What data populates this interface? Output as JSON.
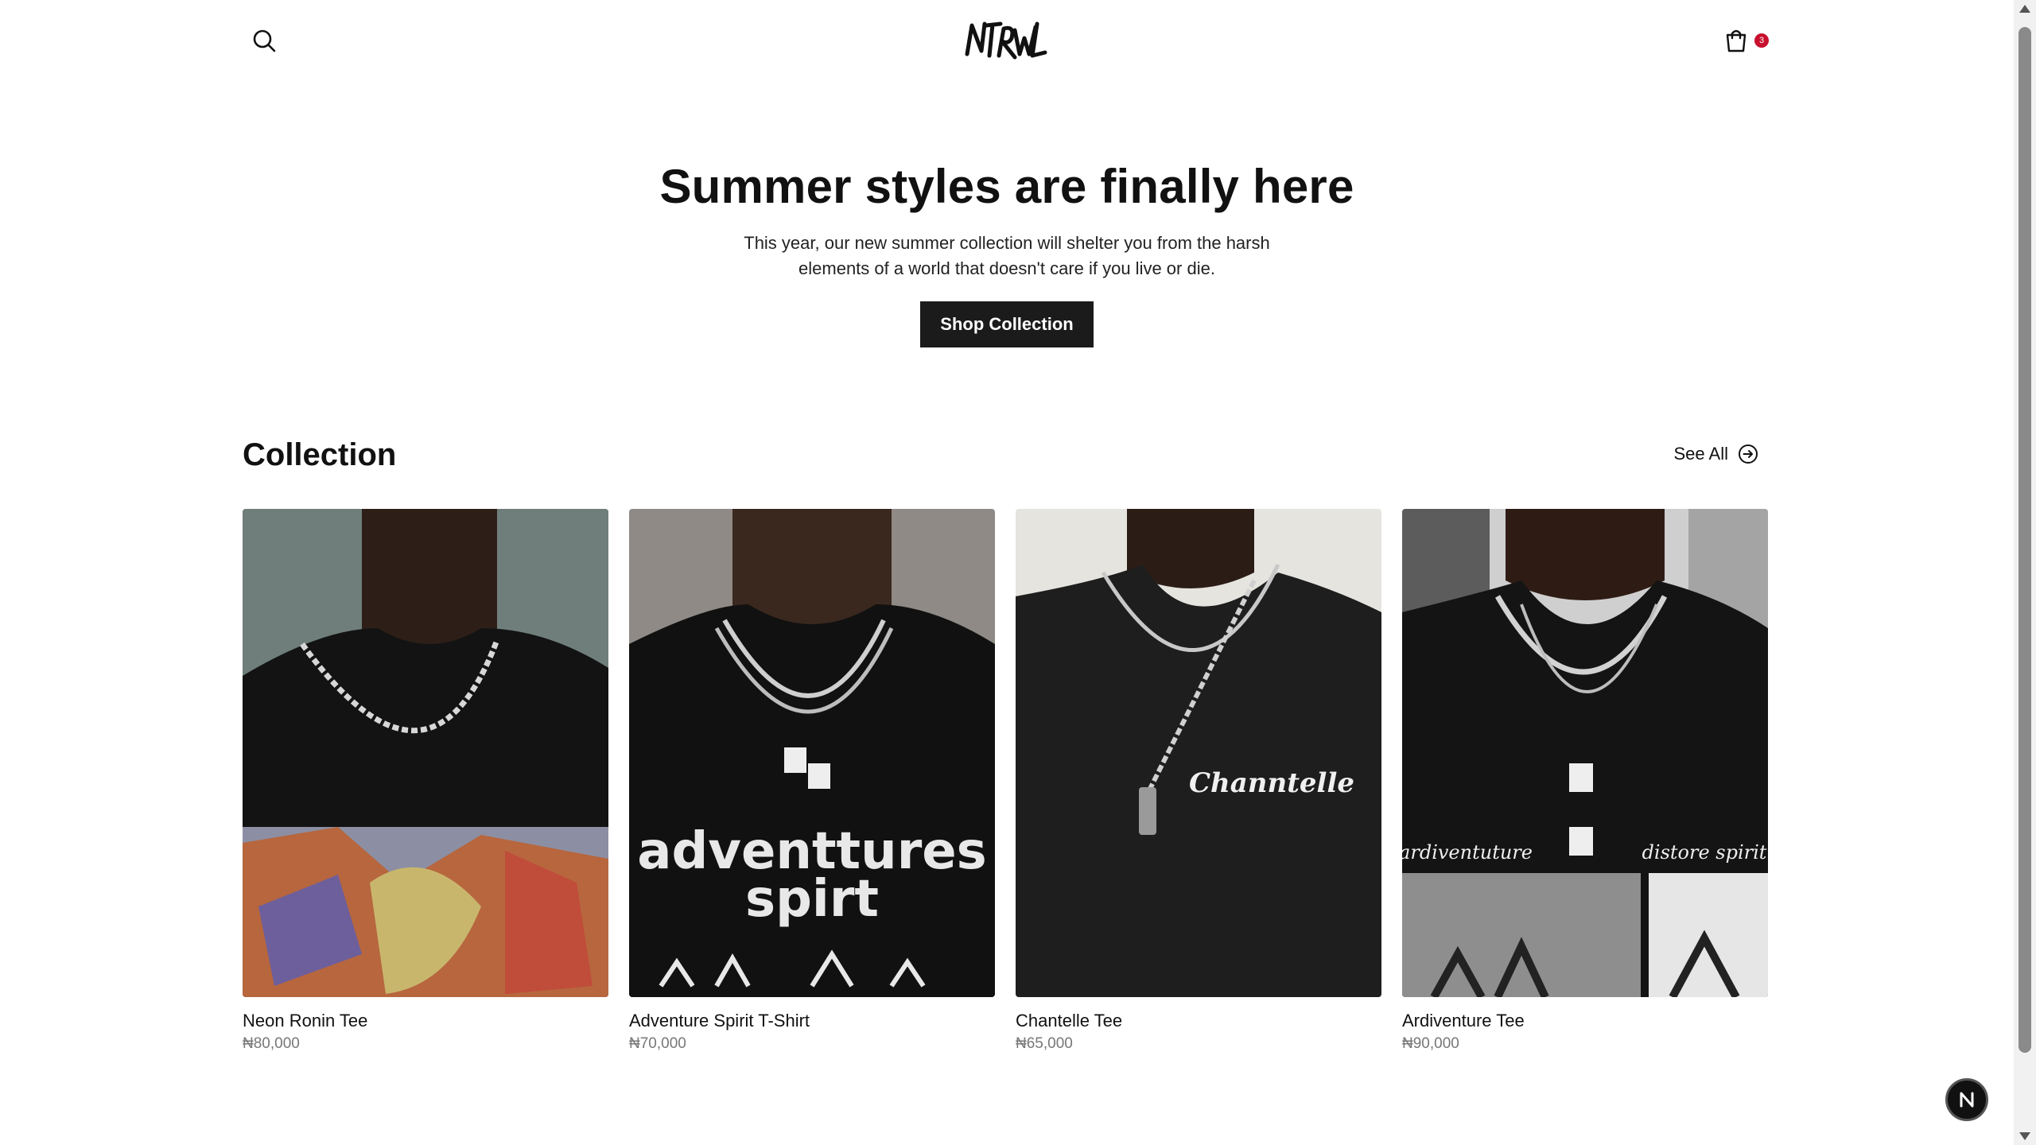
{
  "header": {
    "logo_text": "NTRWL",
    "cart_count": "3"
  },
  "hero": {
    "title": "Summer styles are finally here",
    "text": "This year, our new summer collection will shelter you from the harsh elements of a world that doesn't care if you live or die.",
    "button_label": "Shop Collection"
  },
  "collection": {
    "title": "Collection",
    "see_all_label": "See All",
    "products": [
      {
        "name": "Neon Ronin Tee",
        "price": "₦80,000"
      },
      {
        "name": "Adventure Spirit T-Shirt",
        "price": "₦70,000"
      },
      {
        "name": "Chantelle Tee",
        "price": "₦65,000"
      },
      {
        "name": "Ardiventure Tee",
        "price": "₦90,000"
      }
    ]
  },
  "images": {
    "card2_text_1": "adventtures",
    "card2_text_2": "spirt",
    "card3_text": "Channtelle",
    "card4_text_left": "ardiventuture",
    "card4_text_right": "distore spirit"
  },
  "colors": {
    "badge": "#c8102e",
    "button": "#1b1b1b",
    "price": "#777777"
  },
  "floating_badge": "N"
}
